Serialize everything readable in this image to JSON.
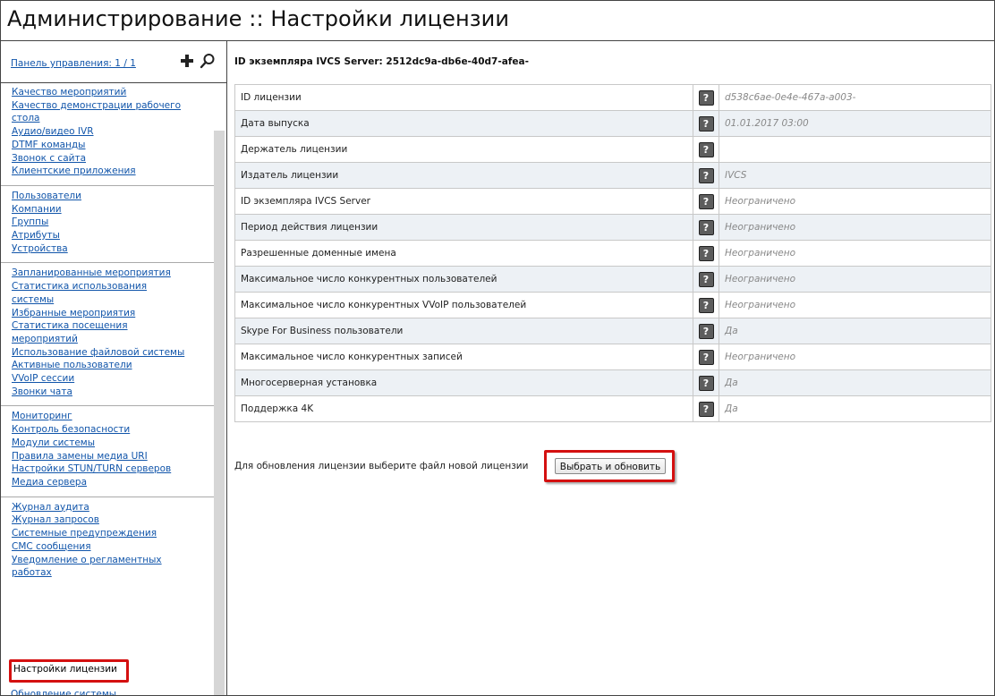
{
  "page": {
    "title": "Администрирование :: Настройки лицензии"
  },
  "sidebar": {
    "panel_label": "Панель управления: 1 / 1",
    "groups": [
      [
        "Качество мероприятий",
        "Качество демонстрации рабочего стола",
        "Аудио/видео IVR",
        "DTMF команды",
        "Звонок с сайта",
        "Клиентские приложения"
      ],
      [
        "Пользователи",
        "Компании",
        "Группы",
        "Атрибуты",
        "Устройства"
      ],
      [
        "Запланированные мероприятия",
        "Статистика использования системы",
        "Избранные мероприятия",
        "Статистика посещения мероприятий",
        "Использование файловой системы",
        "Активные пользователи",
        "VVoIP сессии",
        "Звонки чата"
      ],
      [
        "Мониторинг",
        "Контроль безопасности",
        "Модули системы",
        "Правила замены медиа URI",
        "Настройки STUN/TURN серверов",
        "Медиа сервера"
      ],
      [
        "Журнал аудита",
        "Журнал запросов",
        "Системные предупреждения",
        "СМС сообщения",
        "Уведомление о регламентных работах"
      ]
    ],
    "active_item": "Настройки лицензии",
    "cut_item": "Обновление системы"
  },
  "main": {
    "instance_id_label": "ID экземпляра IVCS Server: 2512dc9a-db6e-40d7-afea-",
    "rows": [
      {
        "name": "ID лицензии",
        "value": "d538c6ae-0e4e-467a-a003-"
      },
      {
        "name": "Дата выпуска",
        "value": "01.01.2017 03:00"
      },
      {
        "name": "Держатель лицензии",
        "value": ""
      },
      {
        "name": "Издатель лицензии",
        "value": "IVCS"
      },
      {
        "name": "ID экземпляра IVCS Server",
        "value": "Неограничено"
      },
      {
        "name": "Период действия лицензии",
        "value": "Неограничено"
      },
      {
        "name": "Разрешенные доменные имена",
        "value": "Неограничено"
      },
      {
        "name": "Максимальное число конкурентных пользователей",
        "value": "Неограничено"
      },
      {
        "name": "Максимальное число конкурентных VVoIP пользователей",
        "value": "Неограничено"
      },
      {
        "name": "Skype For Business пользователи",
        "value": "Да"
      },
      {
        "name": "Максимальное число конкурентных записей",
        "value": "Неограничено"
      },
      {
        "name": "Многосерверная установка",
        "value": "Да"
      },
      {
        "name": "Поддержка 4K",
        "value": "Да"
      }
    ],
    "help_glyph": "?",
    "update_label": "Для обновления лицензии выберите файл новой лицензии",
    "update_button": "Выбрать и обновить"
  },
  "icons": {
    "plus": "plus-icon",
    "search": "search-icon",
    "help": "help-icon"
  },
  "colors": {
    "link": "#1155aa",
    "highlight": "#d41010",
    "row_alt": "#edf1f5"
  }
}
